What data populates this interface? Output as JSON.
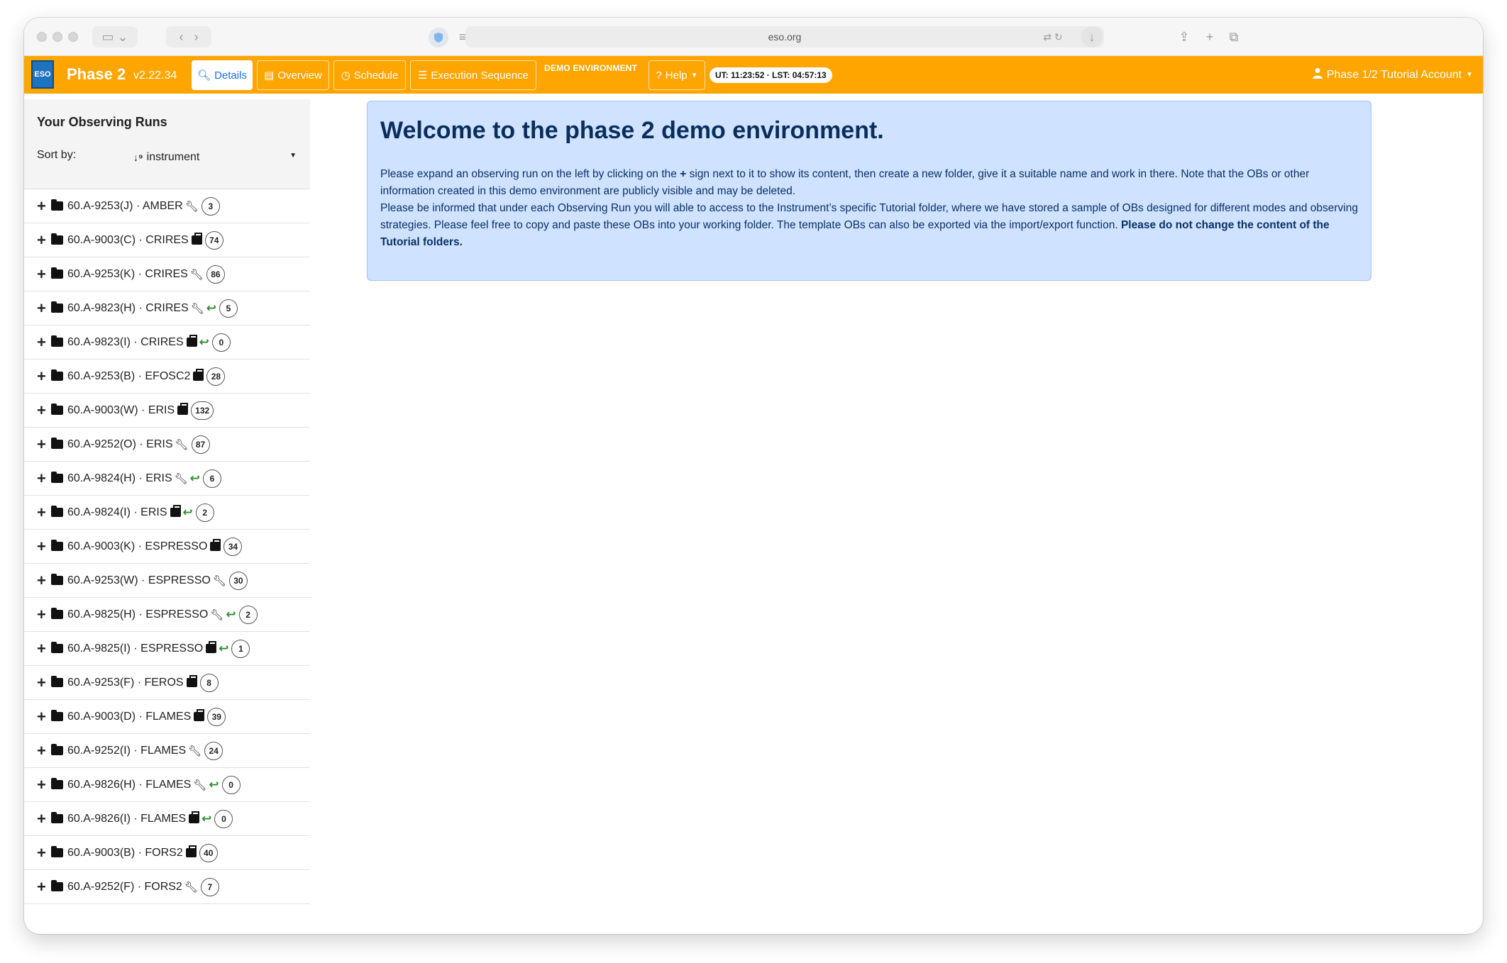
{
  "browser": {
    "url": "eso.org"
  },
  "navbar": {
    "brand": "Phase 2",
    "version": "v2.22.34",
    "buttons": [
      {
        "label": "Details",
        "icon": "search-icon",
        "active": true
      },
      {
        "label": "Overview",
        "icon": "list-icon"
      },
      {
        "label": "Schedule",
        "icon": "clock-icon"
      },
      {
        "label": "Execution Sequence",
        "icon": "ordered-list-icon"
      },
      {
        "label": "Help",
        "icon": "question-icon"
      }
    ],
    "demo_label": "DEMO ENVIRONMENT",
    "clock": "UT: 11:23:52 · LST: 04:57:13",
    "account": "Phase 1/2 Tutorial Account",
    "accent_color": "#ffa500"
  },
  "sidebar": {
    "title": "Your Observing Runs",
    "sort_label": "Sort by:",
    "sort_value": "instrument",
    "runs": [
      {
        "label": "60.A-9253(J) · AMBER",
        "status": "wrench",
        "returned": false,
        "count": "3"
      },
      {
        "label": "60.A-9003(C) · CRIRES",
        "status": "case",
        "returned": false,
        "count": "74"
      },
      {
        "label": "60.A-9253(K) · CRIRES",
        "status": "wrench",
        "returned": false,
        "count": "86"
      },
      {
        "label": "60.A-9823(H) · CRIRES",
        "status": "wrench",
        "returned": true,
        "count": "5"
      },
      {
        "label": "60.A-9823(I) · CRIRES",
        "status": "case",
        "returned": true,
        "count": "0"
      },
      {
        "label": "60.A-9253(B) · EFOSC2",
        "status": "case",
        "returned": false,
        "count": "28"
      },
      {
        "label": "60.A-9003(W) · ERIS",
        "status": "case",
        "returned": false,
        "count": "132"
      },
      {
        "label": "60.A-9252(O) · ERIS",
        "status": "wrench",
        "returned": false,
        "count": "87"
      },
      {
        "label": "60.A-9824(H) · ERIS",
        "status": "wrench",
        "returned": true,
        "count": "6"
      },
      {
        "label": "60.A-9824(I) · ERIS",
        "status": "case",
        "returned": true,
        "count": "2"
      },
      {
        "label": "60.A-9003(K) · ESPRESSO",
        "status": "case",
        "returned": false,
        "count": "34"
      },
      {
        "label": "60.A-9253(W) · ESPRESSO",
        "status": "wrench",
        "returned": false,
        "count": "30"
      },
      {
        "label": "60.A-9825(H) · ESPRESSO",
        "status": "wrench",
        "returned": true,
        "count": "2"
      },
      {
        "label": "60.A-9825(I) · ESPRESSO",
        "status": "case",
        "returned": true,
        "count": "1"
      },
      {
        "label": "60.A-9253(F) · FEROS",
        "status": "case",
        "returned": false,
        "count": "8"
      },
      {
        "label": "60.A-9003(D) · FLAMES",
        "status": "case",
        "returned": false,
        "count": "39"
      },
      {
        "label": "60.A-9252(I) · FLAMES",
        "status": "wrench",
        "returned": false,
        "count": "24"
      },
      {
        "label": "60.A-9826(H) · FLAMES",
        "status": "wrench",
        "returned": true,
        "count": "0"
      },
      {
        "label": "60.A-9826(I) · FLAMES",
        "status": "case",
        "returned": true,
        "count": "0"
      },
      {
        "label": "60.A-9003(B) · FORS2",
        "status": "case",
        "returned": false,
        "count": "40"
      },
      {
        "label": "60.A-9252(F) · FORS2",
        "status": "wrench",
        "returned": false,
        "count": "7"
      }
    ]
  },
  "welcome": {
    "title": "Welcome to the phase 2 demo environment.",
    "p1_a": "Please expand an observing run on the left by clicking on the",
    "p1_b": "sign next to it to show its content, then create a new folder, give it a suitable name and work in there. Note that the OBs or other information created in this demo environment are publicly visible and may be deleted.",
    "p2": "Please be informed that under each Observing Run you will able to access to the Instrument’s specific Tutorial folder, where we have stored a sample of OBs designed for different modes and observing strategies. Please feel free to copy and paste these OBs into your working folder. The template OBs can also be exported via the import/export function.",
    "p2_bold": "Please do not change the content of the Tutorial folders."
  }
}
